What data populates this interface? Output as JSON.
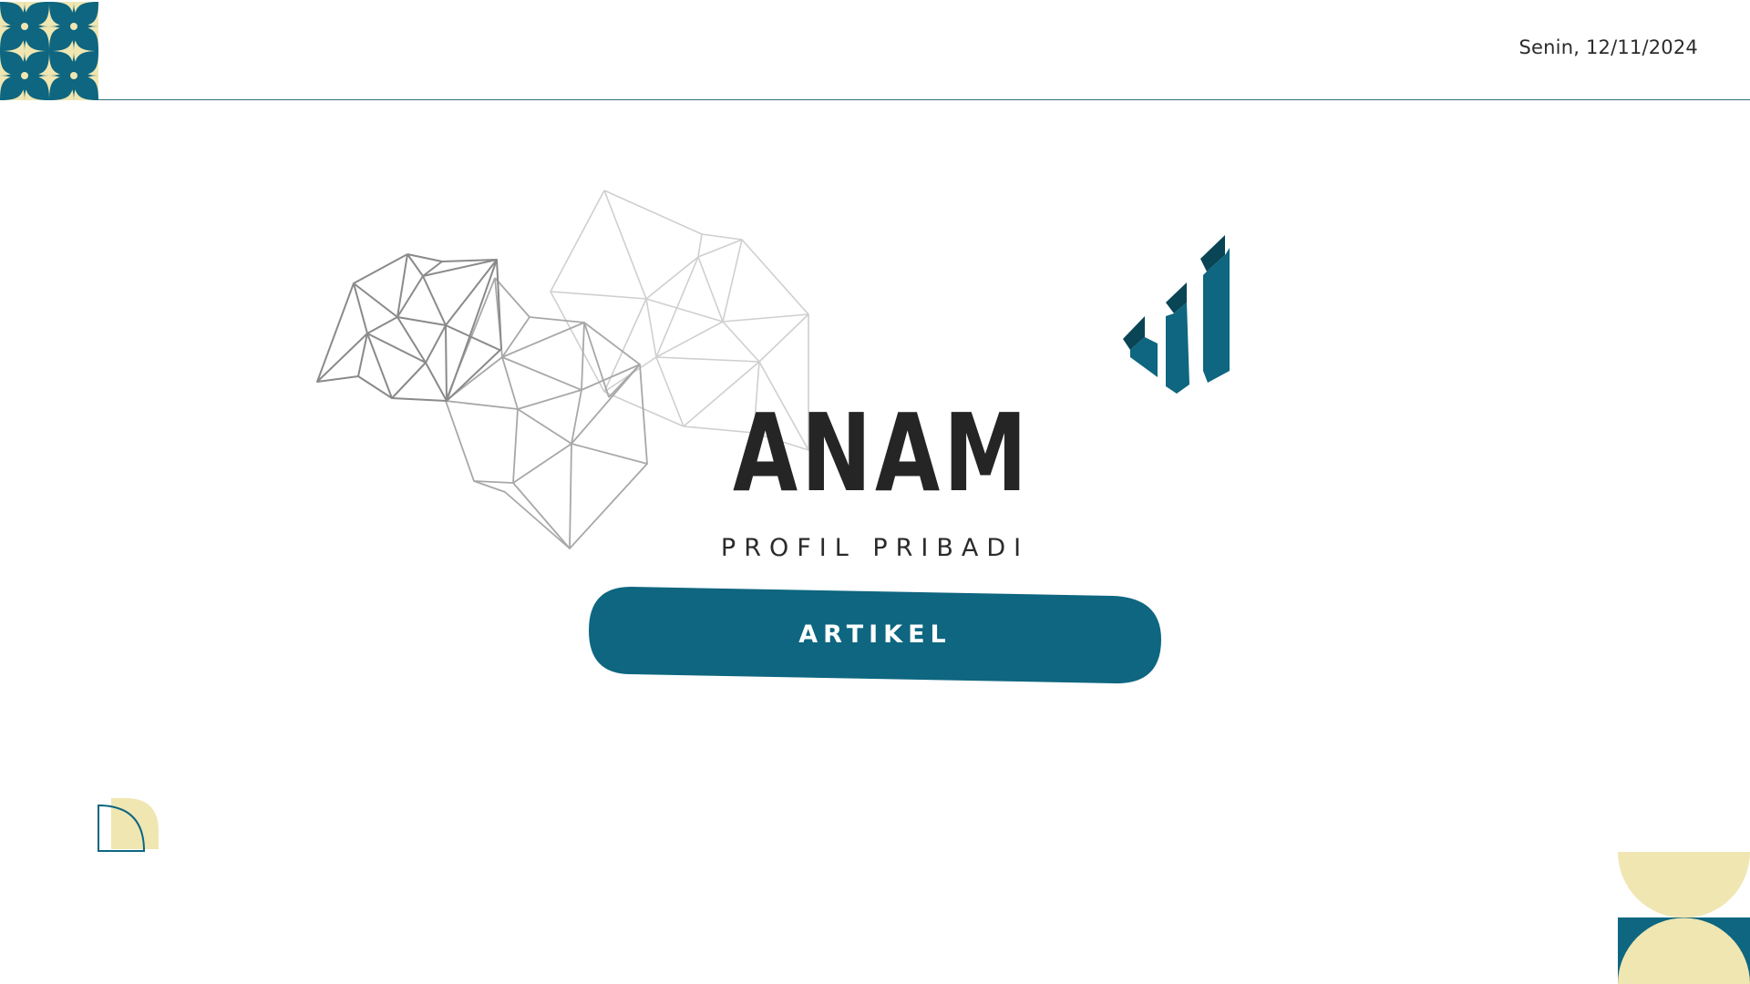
{
  "header": {
    "date": "Senin, 12/11/2024"
  },
  "hero": {
    "title": "ANAM",
    "subtitle": "PROFIL PRIBADI",
    "button_label": "ARTIKEL"
  },
  "icons": {
    "corner": "quatrefoil-pattern-icon",
    "network": "polygon-network-icon",
    "bars": "bar-chart-icon",
    "quarter": "quarter-circle-icon",
    "semicircles": "semicircle-pattern-icon"
  },
  "colors": {
    "teal": "#0e6680",
    "dark_teal": "#0a4556",
    "cream": "#f0e6b2",
    "text": "#252525",
    "line": "#2f6f80"
  }
}
